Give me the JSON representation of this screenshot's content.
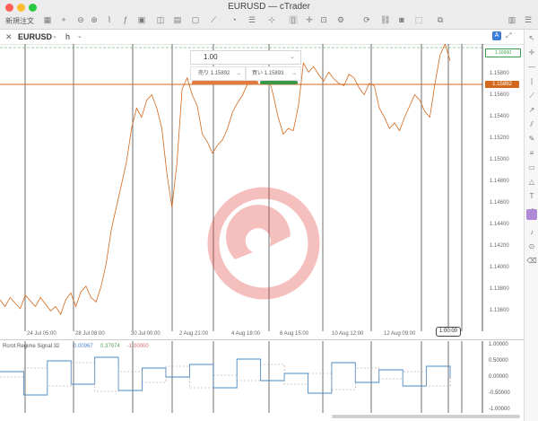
{
  "window": {
    "title": "EURUSD — cTrader"
  },
  "toolbar": {
    "new_order_label": "新規注文"
  },
  "symbol_bar": {
    "symbol": "EURUSD",
    "timeframe": "h"
  },
  "order_panel": {
    "volume": "1.00",
    "sell_label": "売り",
    "sell_price": "1.15892",
    "buy_label": "買い",
    "buy_price": "1.15893",
    "sell_color": "#e07a3f",
    "buy_color": "#3a9a4a"
  },
  "watermark_label": "cTrader",
  "price_axis": {
    "ticks": [
      "1.16000",
      "1.15800",
      "1.15600",
      "1.15400",
      "1.15200",
      "1.15000",
      "1.14800",
      "1.14600",
      "1.14400",
      "1.14200",
      "1.14000",
      "1.13800",
      "1.13600"
    ],
    "current_price": "1.15892",
    "current_color": "#d2691e",
    "top_marker": "1.16000"
  },
  "time_axis": {
    "labels": [
      "24 Jul 05:00",
      "28 Jul 08:00",
      "30 Jul 00:00",
      "2 Aug 21:00",
      "4 Aug 18:00",
      "6 Aug 15:00",
      "10 Aug 12:00",
      "12 Aug 09:00"
    ],
    "cursor_label": "1:00:00"
  },
  "indicator": {
    "name": "Rcrot Regime Signal 32",
    "values": [
      "0.00967",
      "0.37974",
      "-1.00000"
    ],
    "value_colors": [
      "#4a89c8",
      "#5aa25a",
      "#d96a6a"
    ],
    "axis_ticks": [
      "1.00000",
      "0.50000",
      "0.00000",
      "-0.50000",
      "-1.00000"
    ]
  },
  "chart_data": {
    "type": "line",
    "title": "",
    "xlabel": "",
    "ylabel": "",
    "ylim": [
      1.135,
      1.1605
    ],
    "series": [
      {
        "values": [
          1.1378,
          1.1372,
          1.138,
          1.1375,
          1.137,
          1.1382,
          1.1377,
          1.1372,
          1.138,
          1.1374,
          1.1368,
          1.1372,
          1.1365,
          1.1378,
          1.1384,
          1.1372,
          1.1385,
          1.139,
          1.138,
          1.1376,
          1.139,
          1.141,
          1.144,
          1.146,
          1.148,
          1.15,
          1.153,
          1.1548,
          1.154,
          1.1555,
          1.156,
          1.1548,
          1.153,
          1.149,
          1.146,
          1.15,
          1.1565,
          1.1575,
          1.156,
          1.155,
          1.1525,
          1.1518,
          1.1508,
          1.1515,
          1.152,
          1.153,
          1.1545,
          1.1553,
          1.156,
          1.157,
          1.158,
          1.1575,
          1.1585,
          1.1578,
          1.156,
          1.154,
          1.1525,
          1.153,
          1.1528,
          1.155,
          1.1588,
          1.158,
          1.1585,
          1.1578,
          1.1572,
          1.158,
          1.1574,
          1.157,
          1.1568,
          1.1578,
          1.1575,
          1.1566,
          1.156,
          1.157,
          1.1568,
          1.1548,
          1.154,
          1.153,
          1.1535,
          1.1528,
          1.154,
          1.155,
          1.156,
          1.1555,
          1.1545,
          1.154,
          1.157,
          1.1595,
          1.1605,
          1.159
        ]
      }
    ]
  }
}
